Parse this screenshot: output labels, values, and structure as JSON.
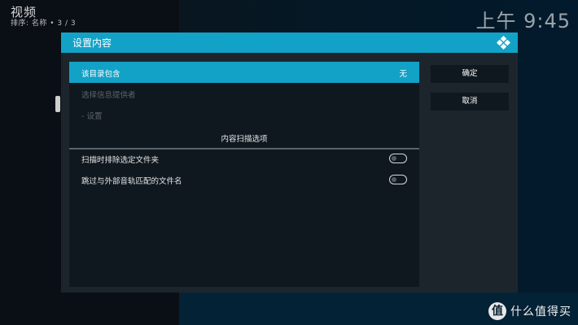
{
  "header": {
    "title": "视频",
    "subtitle": "排序: 名称  •  3 / 3"
  },
  "clock": "上午 9:45",
  "dialog": {
    "title": "设置内容",
    "logo_icon": "kodi-logo-icon",
    "rows": [
      {
        "label": "该目录包含",
        "value": "无"
      },
      {
        "label": "选择信息提供者"
      },
      {
        "label": "- 设置"
      }
    ],
    "section_title": "内容扫描选项",
    "options": [
      {
        "label": "扫描时排除选定文件夹",
        "state": "off"
      },
      {
        "label": "跳过与外部音轨匹配的文件名",
        "state": "off"
      }
    ],
    "ok_label": "确定",
    "cancel_label": "取消"
  },
  "watermark": {
    "logo_glyph": "值",
    "text": "什么值得买"
  },
  "colors": {
    "accent": "#12a2c7",
    "dialog_bg": "#1d252c",
    "panel_bg": "#0f181f"
  }
}
